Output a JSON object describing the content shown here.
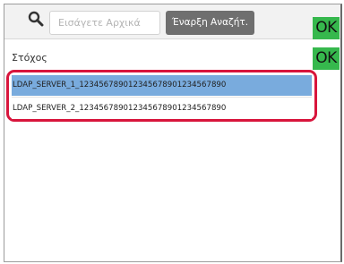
{
  "search": {
    "placeholder": "Εισάγετε Αρχικά"
  },
  "toolbar": {
    "start_search_label": "Έναρξη Αναζήτ.",
    "ok_label": "OK"
  },
  "target": {
    "label": "Στόχος",
    "ok_label": "OK"
  },
  "list": {
    "items": [
      {
        "label": "LDAP_SERVER_1_1234567890123456789012345678​90",
        "selected": true
      },
      {
        "label": "LDAP_SERVER_2_123456789012345678901234567890",
        "selected": false
      }
    ]
  },
  "colors": {
    "ok_button": "#36b84d",
    "selected_row": "#79abdd",
    "highlight_frame": "#d8153c",
    "search_button": "#6f6f6f"
  }
}
